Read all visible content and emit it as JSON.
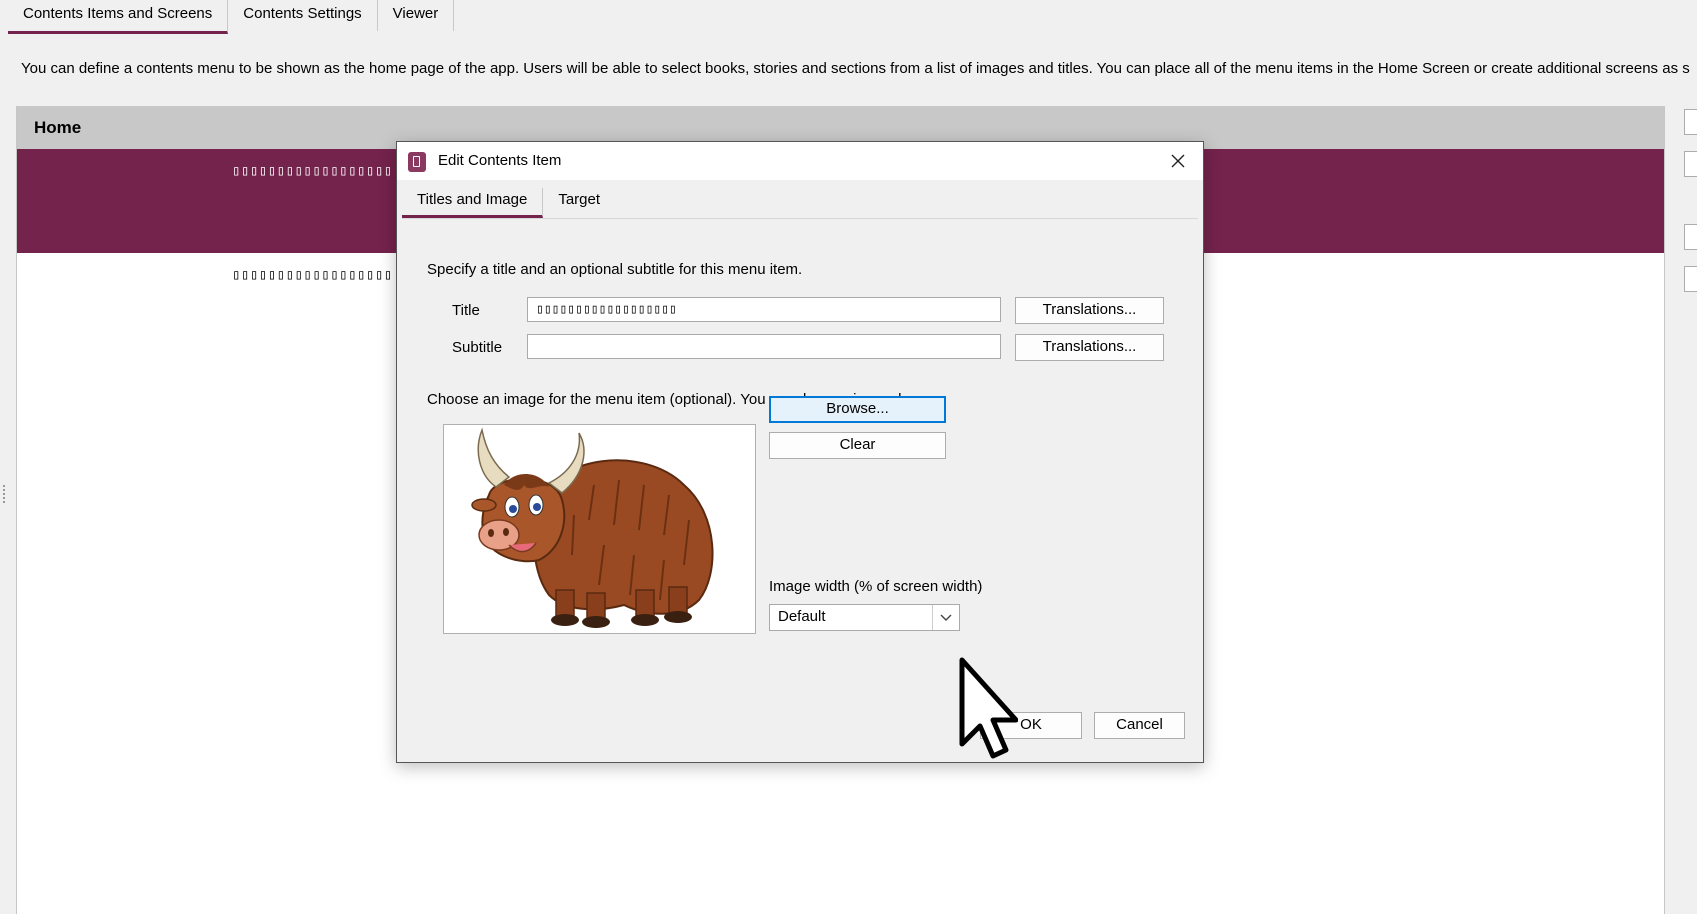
{
  "top_tabs": [
    {
      "label": "Contents Items and Screens",
      "active": true
    },
    {
      "label": "Contents Settings",
      "active": false
    },
    {
      "label": "Viewer",
      "active": false
    }
  ],
  "description": "You can define a contents menu to be shown as the home page of the app. Users will be able to select books, stories and sections from a list of images and titles. You can place all of the menu items in the Home Screen or create additional screens as s",
  "home": {
    "header": "Home",
    "rows": [
      {
        "label": "▯▯▯▯▯▯▯▯▯▯▯▯▯▯▯▯▯▯",
        "selected": true
      },
      {
        "label": "▯▯▯▯▯▯▯▯▯▯▯▯▯▯▯▯▯▯",
        "selected": false
      }
    ]
  },
  "dialog": {
    "title": "Edit Contents Item",
    "close_icon": "close-icon",
    "tabs": [
      {
        "label": "Titles and Image",
        "active": true
      },
      {
        "label": "Target",
        "active": false
      }
    ],
    "instruction_title": "Specify a title and an optional subtitle for this menu item.",
    "title_label": "Title",
    "title_value": "▯▯▯▯▯▯▯▯▯▯▯▯▯▯▯▯▯▯",
    "subtitle_label": "Subtitle",
    "subtitle_value": "",
    "translations_label": "Translations...",
    "instruction_image": "Choose an image for the menu item (optional). You can drag an image here.",
    "image_alt": "yak",
    "browse_label": "Browse...",
    "clear_label": "Clear",
    "image_width_label": "Image width (% of screen width)",
    "image_width_value": "Default",
    "ok_label": "OK",
    "cancel_label": "Cancel"
  },
  "colors": {
    "accent": "#74234c",
    "focus": "#0078d7"
  }
}
